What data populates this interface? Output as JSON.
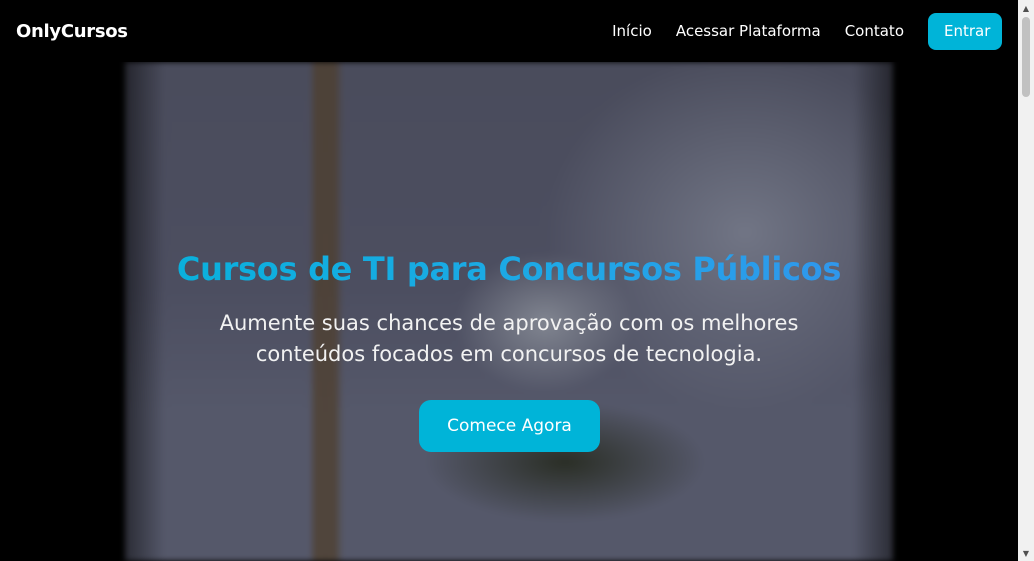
{
  "navbar": {
    "brand": "OnlyCursos",
    "links": [
      {
        "label": "Início"
      },
      {
        "label": "Acessar Plataforma"
      },
      {
        "label": "Contato"
      }
    ],
    "enter_label": "Entrar"
  },
  "hero": {
    "title": "Cursos de TI para Concursos Públicos",
    "subtitle": "Aumente suas chances de aprovação com os melhores conteúdos focados em concursos de tecnologia.",
    "cta_label": "Comece Agora"
  },
  "colors": {
    "accent": "#00b4d8",
    "title_gradient_end": "#3a8cf0",
    "background": "#000000"
  },
  "icons": {
    "scroll_up": "chevron-up-icon",
    "scroll_down": "chevron-down-icon"
  }
}
